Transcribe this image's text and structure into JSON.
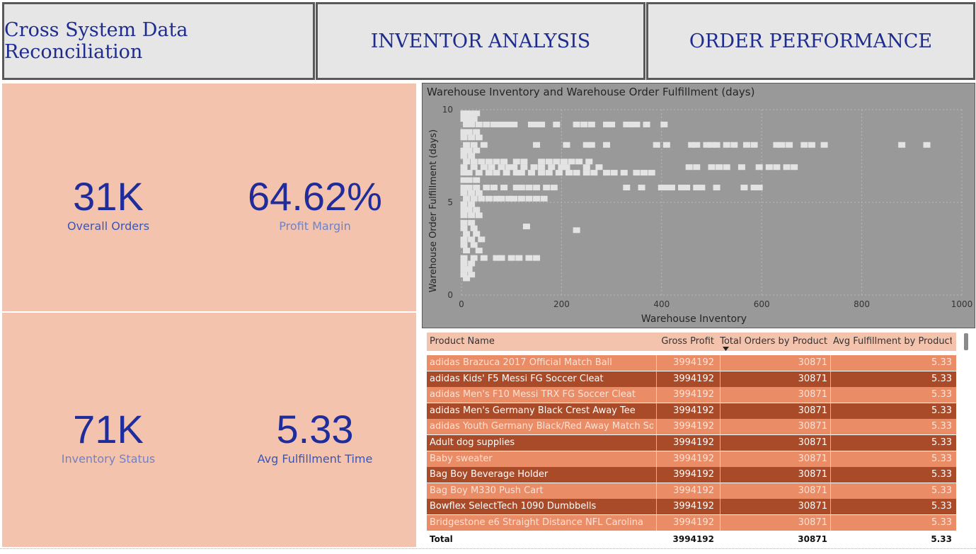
{
  "nav": {
    "reconciliation": "Cross System Data Reconciliation",
    "inventory": "INVENTOR ANALYSIS",
    "orders": "ORDER PERFORMANCE"
  },
  "kpis": [
    {
      "value": "31K",
      "label": "Overall Orders",
      "label_color": "#3a56b5"
    },
    {
      "value": "64.62%",
      "label": "Profit Margin",
      "label_color": "#6f82c7"
    },
    {
      "value": "71K",
      "label": "Inventory Status",
      "label_color": "#6f82c7"
    },
    {
      "value": "5.33",
      "label": "Avg Fulfillment Time",
      "label_color": "#3a56b5"
    }
  ],
  "colors": {
    "kpi_bg": "#f4c3ad",
    "kpi_value": "#1f2c9c",
    "nav_text": "#1f2c8f",
    "row_light": "#ea8c66",
    "row_dark": "#a94b28",
    "scatter_bg": "#999999",
    "point": "#e3e3e3"
  },
  "chart_data": {
    "type": "scatter",
    "title": "Warehouse Inventory and Warehouse Order Fulfillment (days)",
    "xlabel": "Warehouse Inventory",
    "ylabel": "Warehouse Order Fulfillment (days)",
    "xlim": [
      0,
      1000
    ],
    "ylim": [
      0,
      10
    ],
    "x_ticks": [
      "0",
      "200",
      "400",
      "600",
      "800",
      "1000"
    ],
    "y_ticks": [
      "0",
      "5",
      "10"
    ],
    "grid": true,
    "points": [
      [
        5,
        9.8
      ],
      [
        10,
        9.8
      ],
      [
        20,
        9.8
      ],
      [
        30,
        9.8
      ],
      [
        5,
        9.5
      ],
      [
        15,
        9.5
      ],
      [
        25,
        9.5
      ],
      [
        10,
        9.2
      ],
      [
        20,
        9.2
      ],
      [
        35,
        9.2
      ],
      [
        50,
        9.2
      ],
      [
        65,
        9.2
      ],
      [
        75,
        9.2
      ],
      [
        85,
        9.2
      ],
      [
        95,
        9.2
      ],
      [
        105,
        9.2
      ],
      [
        140,
        9.2
      ],
      [
        150,
        9.2
      ],
      [
        160,
        9.2
      ],
      [
        190,
        9.2
      ],
      [
        230,
        9.2
      ],
      [
        245,
        9.2
      ],
      [
        260,
        9.2
      ],
      [
        290,
        9.2
      ],
      [
        300,
        9.2
      ],
      [
        330,
        9.2
      ],
      [
        340,
        9.2
      ],
      [
        350,
        9.2
      ],
      [
        370,
        9.2
      ],
      [
        405,
        9.2
      ],
      [
        5,
        8.8
      ],
      [
        15,
        8.8
      ],
      [
        30,
        8.8
      ],
      [
        5,
        8.5
      ],
      [
        20,
        8.5
      ],
      [
        35,
        8.5
      ],
      [
        10,
        8.1
      ],
      [
        25,
        8.1
      ],
      [
        45,
        8.1
      ],
      [
        150,
        8.1
      ],
      [
        210,
        8.1
      ],
      [
        250,
        8.1
      ],
      [
        260,
        8.1
      ],
      [
        290,
        8.1
      ],
      [
        390,
        8.1
      ],
      [
        410,
        8.1
      ],
      [
        460,
        8.1
      ],
      [
        470,
        8.1
      ],
      [
        490,
        8.1
      ],
      [
        500,
        8.1
      ],
      [
        510,
        8.1
      ],
      [
        530,
        8.1
      ],
      [
        545,
        8.1
      ],
      [
        570,
        8.1
      ],
      [
        585,
        8.1
      ],
      [
        630,
        8.1
      ],
      [
        640,
        8.1
      ],
      [
        655,
        8.1
      ],
      [
        685,
        8.1
      ],
      [
        700,
        8.1
      ],
      [
        725,
        8.1
      ],
      [
        880,
        8.1
      ],
      [
        930,
        8.1
      ],
      [
        5,
        7.8
      ],
      [
        15,
        7.8
      ],
      [
        30,
        7.8
      ],
      [
        5,
        7.5
      ],
      [
        20,
        7.5
      ],
      [
        10,
        7.2
      ],
      [
        25,
        7.2
      ],
      [
        40,
        7.2
      ],
      [
        55,
        7.2
      ],
      [
        70,
        7.2
      ],
      [
        85,
        7.2
      ],
      [
        110,
        7.2
      ],
      [
        125,
        7.2
      ],
      [
        160,
        7.2
      ],
      [
        175,
        7.2
      ],
      [
        190,
        7.2
      ],
      [
        205,
        7.2
      ],
      [
        220,
        7.2
      ],
      [
        235,
        7.2
      ],
      [
        255,
        7.2
      ],
      [
        5,
        6.9
      ],
      [
        25,
        6.9
      ],
      [
        45,
        6.9
      ],
      [
        60,
        6.9
      ],
      [
        80,
        6.9
      ],
      [
        95,
        6.9
      ],
      [
        105,
        6.9
      ],
      [
        125,
        6.9
      ],
      [
        145,
        6.9
      ],
      [
        160,
        6.9
      ],
      [
        180,
        6.9
      ],
      [
        200,
        6.9
      ],
      [
        210,
        6.9
      ],
      [
        250,
        6.9
      ],
      [
        275,
        6.9
      ],
      [
        455,
        6.9
      ],
      [
        470,
        6.9
      ],
      [
        500,
        6.9
      ],
      [
        515,
        6.9
      ],
      [
        530,
        6.9
      ],
      [
        560,
        6.9
      ],
      [
        595,
        6.9
      ],
      [
        615,
        6.9
      ],
      [
        630,
        6.9
      ],
      [
        650,
        6.9
      ],
      [
        665,
        6.9
      ],
      [
        5,
        6.6
      ],
      [
        15,
        6.6
      ],
      [
        35,
        6.6
      ],
      [
        55,
        6.6
      ],
      [
        70,
        6.6
      ],
      [
        90,
        6.6
      ],
      [
        110,
        6.6
      ],
      [
        120,
        6.6
      ],
      [
        140,
        6.6
      ],
      [
        160,
        6.6
      ],
      [
        175,
        6.6
      ],
      [
        195,
        6.6
      ],
      [
        215,
        6.6
      ],
      [
        230,
        6.6
      ],
      [
        250,
        6.6
      ],
      [
        265,
        6.6
      ],
      [
        290,
        6.6
      ],
      [
        305,
        6.6
      ],
      [
        325,
        6.6
      ],
      [
        350,
        6.6
      ],
      [
        365,
        6.6
      ],
      [
        380,
        6.6
      ],
      [
        5,
        6.2
      ],
      [
        15,
        6.2
      ],
      [
        30,
        6.2
      ],
      [
        5,
        5.8
      ],
      [
        15,
        5.8
      ],
      [
        30,
        5.8
      ],
      [
        50,
        5.8
      ],
      [
        65,
        5.8
      ],
      [
        85,
        5.8
      ],
      [
        110,
        5.8
      ],
      [
        120,
        5.8
      ],
      [
        135,
        5.8
      ],
      [
        150,
        5.8
      ],
      [
        170,
        5.8
      ],
      [
        185,
        5.8
      ],
      [
        330,
        5.8
      ],
      [
        360,
        5.8
      ],
      [
        400,
        5.8
      ],
      [
        410,
        5.8
      ],
      [
        420,
        5.8
      ],
      [
        440,
        5.8
      ],
      [
        450,
        5.8
      ],
      [
        470,
        5.8
      ],
      [
        480,
        5.8
      ],
      [
        510,
        5.8
      ],
      [
        565,
        5.8
      ],
      [
        585,
        5.8
      ],
      [
        595,
        5.8
      ],
      [
        5,
        5.5
      ],
      [
        20,
        5.5
      ],
      [
        35,
        5.5
      ],
      [
        10,
        5.2
      ],
      [
        25,
        5.2
      ],
      [
        40,
        5.2
      ],
      [
        55,
        5.2
      ],
      [
        70,
        5.2
      ],
      [
        80,
        5.2
      ],
      [
        95,
        5.2
      ],
      [
        105,
        5.2
      ],
      [
        120,
        5.2
      ],
      [
        135,
        5.2
      ],
      [
        150,
        5.2
      ],
      [
        165,
        5.2
      ],
      [
        5,
        4.9
      ],
      [
        20,
        4.9
      ],
      [
        5,
        4.6
      ],
      [
        15,
        4.6
      ],
      [
        30,
        4.6
      ],
      [
        5,
        4.3
      ],
      [
        20,
        4.3
      ],
      [
        35,
        4.3
      ],
      [
        130,
        3.7
      ],
      [
        230,
        3.5
      ],
      [
        5,
        3.9
      ],
      [
        20,
        3.9
      ],
      [
        5,
        3.6
      ],
      [
        25,
        3.6
      ],
      [
        10,
        3.3
      ],
      [
        30,
        3.3
      ],
      [
        5,
        3.0
      ],
      [
        20,
        3.0
      ],
      [
        40,
        3.0
      ],
      [
        5,
        2.7
      ],
      [
        25,
        2.7
      ],
      [
        10,
        2.4
      ],
      [
        35,
        2.4
      ],
      [
        5,
        2.0
      ],
      [
        25,
        2.0
      ],
      [
        45,
        2.0
      ],
      [
        70,
        2.0
      ],
      [
        80,
        2.0
      ],
      [
        100,
        2.0
      ],
      [
        115,
        2.0
      ],
      [
        135,
        2.0
      ],
      [
        150,
        2.0
      ],
      [
        5,
        1.7
      ],
      [
        20,
        1.7
      ],
      [
        5,
        1.4
      ],
      [
        15,
        1.4
      ],
      [
        5,
        1.1
      ],
      [
        20,
        1.1
      ],
      [
        10,
        0.9
      ]
    ]
  },
  "table": {
    "headers": [
      "Product Name",
      "Gross Profit",
      "Total Orders by Product",
      "Avg Fulfillment by Product"
    ],
    "rows": [
      [
        "adidas Brazuca 2017 Official Match Ball",
        "3994192",
        "30871",
        "5.33"
      ],
      [
        "adidas Kids' F5 Messi FG Soccer Cleat",
        "3994192",
        "30871",
        "5.33"
      ],
      [
        "adidas Men's F10 Messi TRX FG Soccer Cleat",
        "3994192",
        "30871",
        "5.33"
      ],
      [
        "adidas Men's Germany Black Crest Away Tee",
        "3994192",
        "30871",
        "5.33"
      ],
      [
        "adidas Youth Germany Black/Red Away Match Soc",
        "3994192",
        "30871",
        "5.33"
      ],
      [
        "Adult dog supplies",
        "3994192",
        "30871",
        "5.33"
      ],
      [
        "Baby sweater",
        "3994192",
        "30871",
        "5.33"
      ],
      [
        "Bag Boy Beverage Holder",
        "3994192",
        "30871",
        "5.33"
      ],
      [
        "Bag Boy M330 Push Cart",
        "3994192",
        "30871",
        "5.33"
      ],
      [
        "Bowflex SelectTech 1090 Dumbbells",
        "3994192",
        "30871",
        "5.33"
      ],
      [
        "Bridgestone e6 Straight Distance NFL Carolina",
        "3994192",
        "30871",
        "5.33"
      ]
    ],
    "total": [
      "Total",
      "3994192",
      "30871",
      "5.33"
    ]
  }
}
